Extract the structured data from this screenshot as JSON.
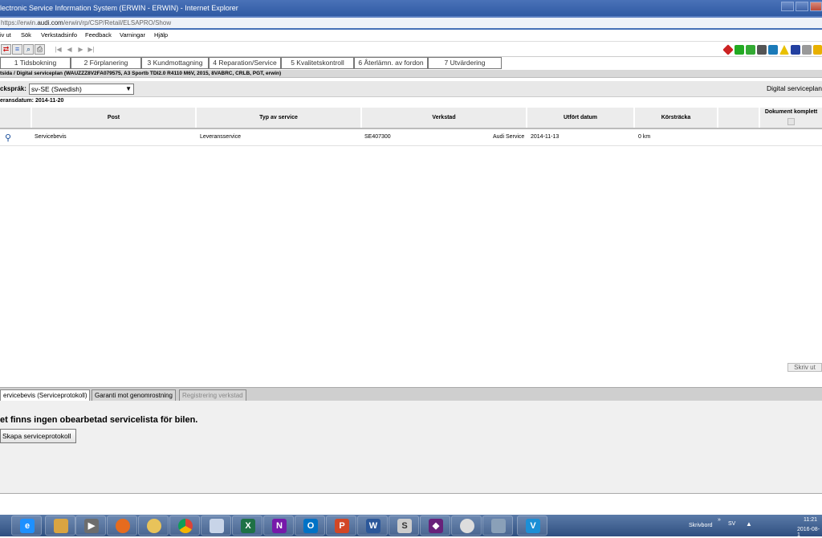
{
  "window": {
    "title": "lectronic Service Information System (ERWIN - ERWIN) - Internet Explorer",
    "url_prefix": "https://erwin.",
    "url_domain": "audi.com",
    "url_rest": "/erwin/rp/CSP/Retail/ELSAPRO/Show"
  },
  "menu": {
    "items": [
      "iv ut",
      "Sök",
      "Verkstadsinfo",
      "Feedback",
      "Varningar",
      "Hjälp"
    ]
  },
  "toolbar": {
    "left_icons": [
      "swap-icon",
      "pages-icon",
      "magnifier-icon",
      "print-icon"
    ],
    "nav_icons": [
      "first-page-icon",
      "previous-icon",
      "next-icon",
      "last-page-icon"
    ],
    "right_icons": [
      "stop-icon",
      "car-icon",
      "car-icon-2",
      "car-icon-3",
      "tools-icon",
      "warning-icon",
      "document-icon",
      "lock-icon",
      "link-icon"
    ]
  },
  "process_tabs": [
    "1 Tidsbokning",
    "2 Förplanering",
    "3 Kundmottagning",
    "4 Reparation/Service",
    "5 Kvalitetskontroll",
    "6 Återlämn. av fordon",
    "7 Utvärdering"
  ],
  "breadcrumb": "tsida / Digital serviceplan (WAUZZZ8V2FA079575, A3 Sportb TDI2.0 R4110 M6V, 2015, 8VABRC, CRLB, PGT, erwin)",
  "language": {
    "label": "cksprak:",
    "label_display": "cksprák:",
    "selected": "sv-SE (Swedish)"
  },
  "page_heading": "Digital serviceplan",
  "delivery_date": "eransdatum: 2014-11-20",
  "table": {
    "headers": [
      "Post",
      "Typ av service",
      "Verkstad",
      "Utfört datum",
      "Körsträcka",
      "Dokument komplett"
    ],
    "rows": [
      {
        "post": "Servicebevis",
        "type": "Leveransservice",
        "workshop_id": "SE407300",
        "workshop_name": "Audi Service",
        "date": "2014-11-13",
        "distance": "0 km"
      }
    ]
  },
  "print_button": "Skriv ut",
  "bottom_tabs": [
    "ervicebevis (Serviceprotokoll)",
    "Garanti mot genomrostning",
    "Registrering verkstad"
  ],
  "bottom_message": "et finns ingen obearbetad servicelista för bilen.",
  "create_button": "Skapa serviceprotokoll",
  "taskbar": {
    "apps": [
      "ie-icon",
      "explorer-icon",
      "media-player-icon",
      "firefox-icon",
      "paint-icon",
      "chrome-icon",
      "notepad-icon",
      "excel-icon",
      "onenote-icon",
      "outlook-icon",
      "powerpoint-icon",
      "word-icon",
      "skype-icon",
      "vs-icon",
      "disc-icon",
      "vehicle-icon",
      "v-icon"
    ],
    "skrivbord": "Skrivbord",
    "chevron": "»",
    "lang": "SV",
    "time": "11:21",
    "date": "2016-08-1"
  }
}
